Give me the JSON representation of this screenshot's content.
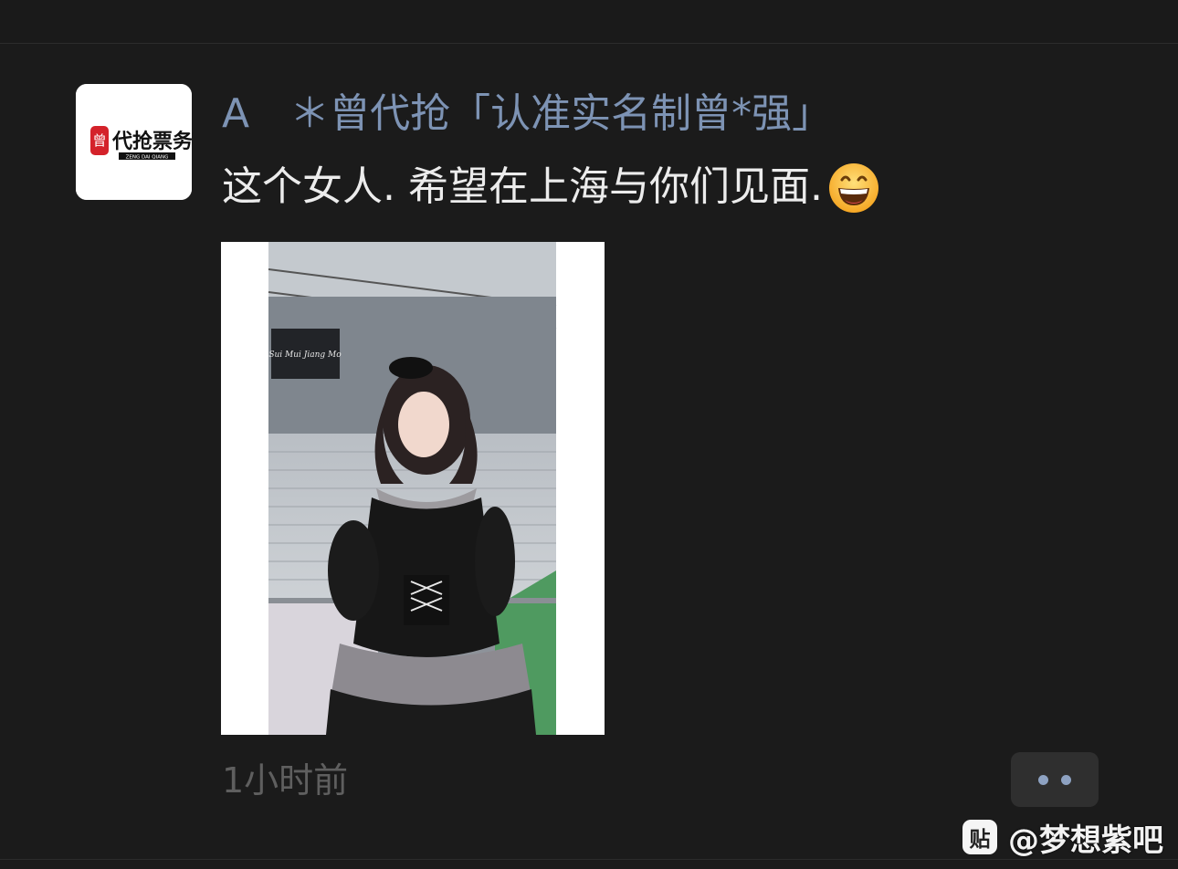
{
  "post": {
    "author_name": "A　＊曾代抢「认准实名制曾*强」",
    "text": "这个女人. 希望在上海与你们见面.",
    "emoji": "grinning-face-emoji",
    "timestamp": "1小时前"
  },
  "avatar": {
    "logo_text": "代抢票务",
    "logo_subtext": "ZENG DAI QIANG",
    "logo_badge": "曾"
  },
  "image": {
    "description_icon": "photo-icon",
    "banner_text": "Sui Mui Jiang Mo"
  },
  "more_button": {
    "icon": "more-dots-icon"
  },
  "watermark": {
    "icon_text": "贴",
    "text": "@梦想紫吧"
  },
  "colors": {
    "background": "#1b1b1b",
    "author": "#7d93b4",
    "text": "#ececec",
    "timestamp": "#5f5f5f",
    "more_button_bg": "#2f2f2f",
    "more_dots": "#8ea2c2"
  }
}
